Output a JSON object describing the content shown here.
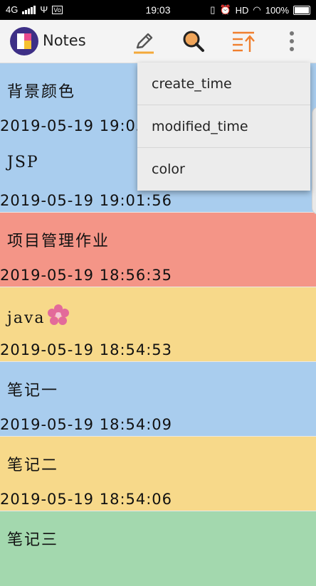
{
  "status_bar": {
    "network": "4G",
    "time": "19:03",
    "hd": "HD",
    "battery": "100%"
  },
  "app_bar": {
    "title": "Notes",
    "icons": [
      "pencil-icon",
      "search-icon",
      "sort-icon",
      "overflow-menu-icon"
    ]
  },
  "notes": [
    {
      "title": "背景颜色",
      "date": "2019-05-19 19:03:06",
      "color": "#a9cdee"
    },
    {
      "title": "JSP",
      "date": "2019-05-19 19:01:56",
      "color": "#a9cdee"
    },
    {
      "title": "项目管理作业",
      "date": "2019-05-19 18:56:35",
      "color": "#f49587"
    },
    {
      "title": "java",
      "date": "2019-05-19 18:54:53",
      "color": "#f7d98a"
    },
    {
      "title": "笔记一",
      "date": "2019-05-19 18:54:09",
      "color": "#a9cdee"
    },
    {
      "title": "笔记二",
      "date": "2019-05-19 18:54:06",
      "color": "#f7d98a"
    },
    {
      "title": "笔记三",
      "date": "",
      "color": "#a3d8ae"
    }
  ],
  "sort_menu": {
    "items": [
      "create_time",
      "modified_time",
      "color"
    ]
  }
}
